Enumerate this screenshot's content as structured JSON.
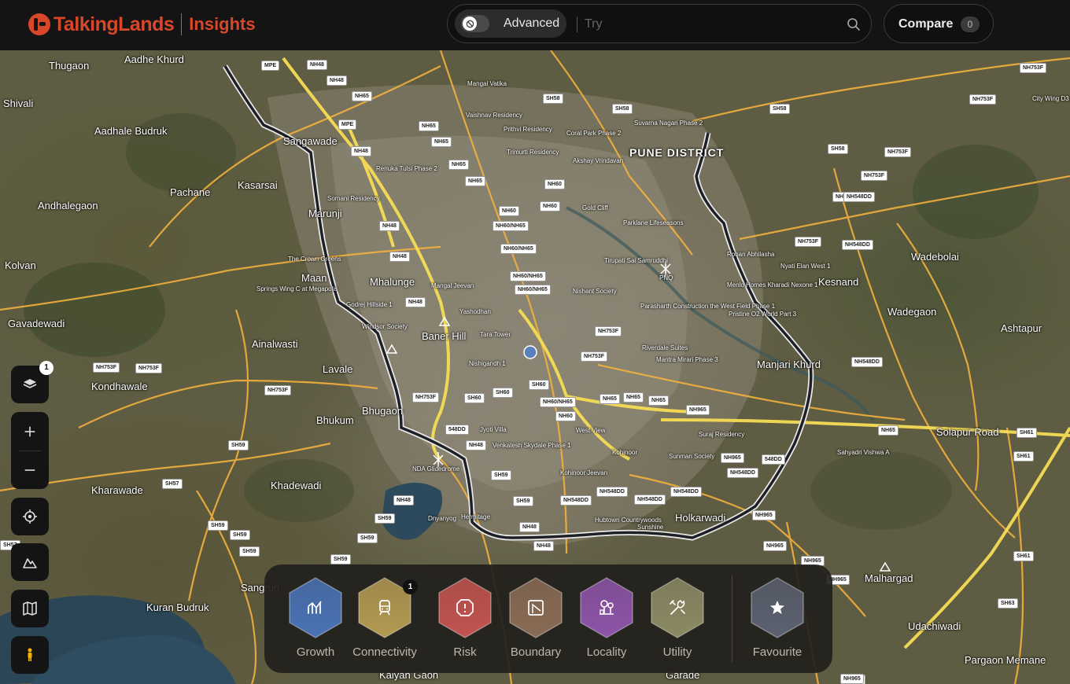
{
  "header": {
    "brand": "TalkingLands",
    "product": "Insights",
    "advanced_label": "Advanced",
    "search_placeholder": "Try",
    "compare_label": "Compare",
    "compare_count": "0"
  },
  "map": {
    "district_label": "PUNE DISTRICT",
    "places": [
      {
        "name": "Aadhe Khurd",
        "cls": ""
      },
      {
        "name": "Thugaon",
        "cls": ""
      },
      {
        "name": "Shivali",
        "cls": ""
      },
      {
        "name": "Aadhale Budruk",
        "cls": ""
      },
      {
        "name": "Pachane",
        "cls": ""
      },
      {
        "name": "Kasarsai",
        "cls": ""
      },
      {
        "name": "Andhalegaon",
        "cls": ""
      },
      {
        "name": "Kolvan",
        "cls": ""
      },
      {
        "name": "Gavadewadi",
        "cls": ""
      },
      {
        "name": "Ainalwasti",
        "cls": ""
      },
      {
        "name": "Lavale",
        "cls": ""
      },
      {
        "name": "Kondhawale",
        "cls": ""
      },
      {
        "name": "Bhukum",
        "cls": ""
      },
      {
        "name": "Kharawade",
        "cls": ""
      },
      {
        "name": "Khadewadi",
        "cls": ""
      },
      {
        "name": "Kuran Budruk",
        "cls": ""
      },
      {
        "name": "Sangrun",
        "cls": ""
      },
      {
        "name": "Mhalunge",
        "cls": ""
      },
      {
        "name": "Maan",
        "cls": ""
      },
      {
        "name": "Marunji",
        "cls": ""
      },
      {
        "name": "Sangawade",
        "cls": ""
      },
      {
        "name": "Baner Hill",
        "cls": ""
      },
      {
        "name": "Bhugaon",
        "cls": ""
      },
      {
        "name": "Holkarwadi",
        "cls": ""
      },
      {
        "name": "Manjari Khurd",
        "cls": ""
      },
      {
        "name": "Kesnand",
        "cls": ""
      },
      {
        "name": "Wadebolai",
        "cls": ""
      },
      {
        "name": "Wadegaon",
        "cls": ""
      },
      {
        "name": "Ashtapur",
        "cls": ""
      },
      {
        "name": "Malhargad",
        "cls": ""
      },
      {
        "name": "Udachiwadi",
        "cls": ""
      },
      {
        "name": "Pargaon Memane",
        "cls": ""
      },
      {
        "name": "Solapur Road",
        "cls": ""
      },
      {
        "name": "Kalyan Gaon",
        "cls": ""
      },
      {
        "name": "Garade",
        "cls": ""
      },
      {
        "name": "NDA Glidedrome",
        "cls": "small"
      },
      {
        "name": "PNQ",
        "cls": "small"
      },
      {
        "name": "Mangal Vatika",
        "cls": "small"
      },
      {
        "name": "Vaishnav Residency",
        "cls": "small"
      },
      {
        "name": "Prithvi Residency",
        "cls": "small"
      },
      {
        "name": "Coral Park Phase 2",
        "cls": "small"
      },
      {
        "name": "Suvarna Nagari Phase 2",
        "cls": "small"
      },
      {
        "name": "Trimurti Residency",
        "cls": "small"
      },
      {
        "name": "Akshay Vrindavan",
        "cls": "small"
      },
      {
        "name": "Renuka Tulsi Phase 2",
        "cls": "small"
      },
      {
        "name": "Somani Residency",
        "cls": "small"
      },
      {
        "name": "Gold Cliff",
        "cls": "small"
      },
      {
        "name": "Parklane Lifeseasons",
        "cls": "small"
      },
      {
        "name": "Tirupati Sai Samruddhi",
        "cls": "small"
      },
      {
        "name": "The Crown Greens",
        "cls": "small"
      },
      {
        "name": "Mangal Jeevan",
        "cls": "small"
      },
      {
        "name": "Nishant Society",
        "cls": "small"
      },
      {
        "name": "Yashodhan",
        "cls": "small"
      },
      {
        "name": "Tara Tower",
        "cls": "small"
      },
      {
        "name": "Nishigandh 1",
        "cls": "small"
      },
      {
        "name": "Riverdale Suites",
        "cls": "small"
      },
      {
        "name": "Mantra Mirari Phase 3",
        "cls": "small"
      },
      {
        "name": "Pristine O2 World Part 3",
        "cls": "small"
      },
      {
        "name": "Menlo Homes Kharadi Nexone 1",
        "cls": "small"
      },
      {
        "name": "Suraj Residency",
        "cls": "small"
      },
      {
        "name": "Sunman Society",
        "cls": "small"
      },
      {
        "name": "Venkatesh Skydale Phase 1",
        "cls": "small"
      },
      {
        "name": "Jyoti Villa",
        "cls": "small"
      },
      {
        "name": "West View",
        "cls": "small"
      },
      {
        "name": "Kohinoor",
        "cls": "small"
      },
      {
        "name": "Kohinoor Jeevan",
        "cls": "small"
      },
      {
        "name": "Hubtown Countrywoods",
        "cls": "small"
      },
      {
        "name": "Sunshine",
        "cls": "small"
      },
      {
        "name": "Sahyadri Vishwa A",
        "cls": "small"
      },
      {
        "name": "Dnyanyog",
        "cls": "small"
      },
      {
        "name": "Hermitage",
        "cls": "small"
      },
      {
        "name": "Springs Wing C at Megapolis",
        "cls": "small"
      },
      {
        "name": "Godrej Hillside 1",
        "cls": "small"
      },
      {
        "name": "Windsor Society",
        "cls": "small"
      },
      {
        "name": "City Wing D3 & D4",
        "cls": "small"
      },
      {
        "name": "Nyati Elan West 1",
        "cls": "small"
      },
      {
        "name": "Rohan Abhilasha",
        "cls": "small"
      },
      {
        "name": "Parasharth Construction the West Field Phase 1",
        "cls": "small"
      }
    ],
    "shields": [
      "MPE",
      "NH48",
      "NH48",
      "NH65",
      "NH65",
      "NH65",
      "NH65",
      "NH65",
      "MPE",
      "NH48",
      "SH58",
      "SH58",
      "SH58",
      "NH60",
      "NH60",
      "NH60",
      "NH60/NH65",
      "NH60/NH65",
      "NH60/NH65",
      "NH60/NH65",
      "NH48",
      "NH48",
      "NH48",
      "NH753F",
      "NH753F",
      "NH753F",
      "NH753F",
      "NH753F",
      "NH753F",
      "NH753F",
      "NH548DD",
      "NH548DD",
      "NH548DD",
      "SH58",
      "NH753F",
      "NH753F",
      "NH753F",
      "NH753F",
      "NH548DD",
      "SH60",
      "SH60",
      "SH60",
      "NH60/NH65",
      "NH60",
      "NH65",
      "NH65",
      "NH65",
      "NH965",
      "NH965",
      "NH548DD",
      "548DD",
      "548DD",
      "NH48",
      "SH59",
      "SH59",
      "NH48",
      "NH48",
      "SH59",
      "SH59",
      "SH59",
      "SH59",
      "SH57",
      "SH59",
      "SH59",
      "SH59",
      "SH57",
      "NH48",
      "NH548DD",
      "NH548DD",
      "NH548DD",
      "NH548DD",
      "NH965",
      "NH965",
      "NH965",
      "NH965",
      "NH965",
      "NH65",
      "SH61",
      "SH61",
      "SH61",
      "SH63",
      "NH965"
    ]
  },
  "controls": {
    "layers_badge": "1",
    "zoom_in": "+",
    "zoom_out": "−"
  },
  "dock": {
    "items": [
      {
        "label": "Growth",
        "color": "#4a73b5",
        "icon": "growth-icon"
      },
      {
        "label": "Connectivity",
        "color": "#b39a52",
        "icon": "train-icon",
        "badge": "1"
      },
      {
        "label": "Risk",
        "color": "#c25450",
        "icon": "alert-icon"
      },
      {
        "label": "Boundary",
        "color": "#8a6c55",
        "icon": "boundary-icon"
      },
      {
        "label": "Locality",
        "color": "#8e54a8",
        "icon": "locality-icon"
      },
      {
        "label": "Utility",
        "color": "#8c8a64",
        "icon": "tools-icon"
      },
      {
        "label": "Favourite",
        "color": "#5c6170",
        "icon": "star-icon"
      }
    ]
  },
  "colors": {
    "brand": "#d9472b",
    "road_primary": "#f2b13d",
    "road_highway": "#f6dc55",
    "ring_road": "#1e2026"
  }
}
